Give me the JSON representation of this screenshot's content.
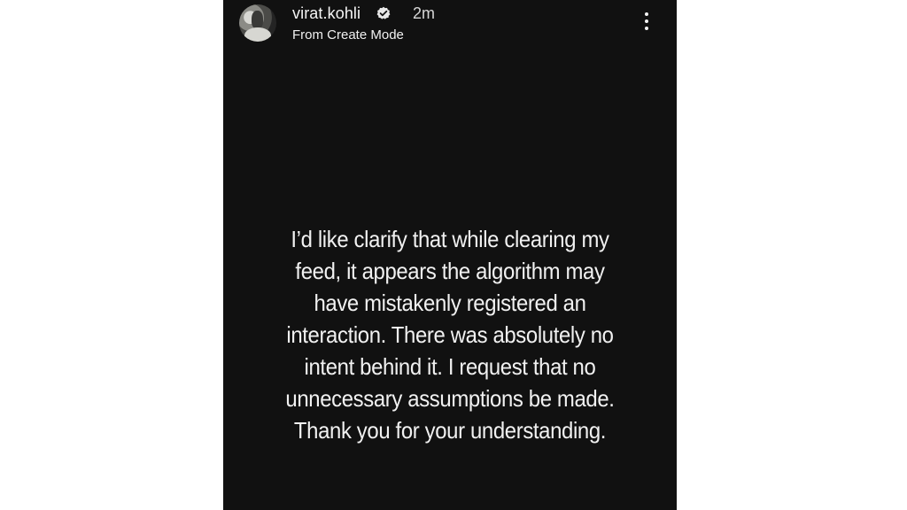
{
  "story": {
    "username": "virat.kohli",
    "verified_icon": "verified-badge-icon",
    "age": "2m",
    "subtitle": "From Create Mode",
    "menu_icon": "more-vertical-icon",
    "message_lines": [
      "I’d like clarify that while clearing my",
      "feed, it appears the algorithm may",
      "have mistakenly registered an",
      "interaction. There was absolutely no",
      "intent behind it. I request that no",
      "unnecessary assumptions be made.",
      "Thank you for your understanding."
    ]
  },
  "colors": {
    "background": "#ffffff",
    "story_background": "#111111",
    "text": "#f1f1f1"
  }
}
